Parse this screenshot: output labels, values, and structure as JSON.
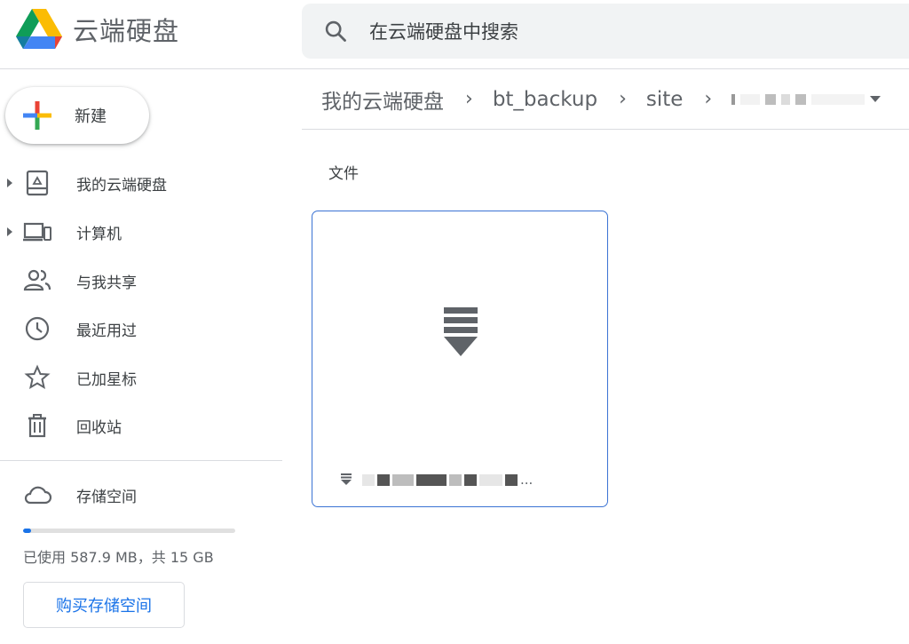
{
  "app": {
    "title": "云端硬盘"
  },
  "search": {
    "placeholder": "在云端硬盘中搜索",
    "icon": "search-icon"
  },
  "sidebar": {
    "new_label": "新建",
    "items": [
      {
        "label": "我的云端硬盘",
        "icon": "my-drive-icon",
        "expandable": true
      },
      {
        "label": "计算机",
        "icon": "computers-icon",
        "expandable": true
      },
      {
        "label": "与我共享",
        "icon": "shared-people-icon",
        "expandable": false
      },
      {
        "label": "最近用过",
        "icon": "clock-icon",
        "expandable": false
      },
      {
        "label": "已加星标",
        "icon": "star-icon",
        "expandable": false
      },
      {
        "label": "回收站",
        "icon": "trash-icon",
        "expandable": false
      }
    ],
    "storage": {
      "label": "存储空间",
      "usage_text": "已使用 587.9 MB，共 15 GB",
      "used_fraction": 0.038,
      "buy_label": "购买存储空间"
    }
  },
  "breadcrumb": {
    "items": [
      "我的云端硬盘",
      "bt_backup",
      "site"
    ]
  },
  "main": {
    "section_label": "文件",
    "file": {
      "name_visible": "...",
      "icon": "download-file-icon"
    }
  },
  "colors": {
    "accent": "#1a73e8",
    "card_border": "#3b73d4"
  }
}
